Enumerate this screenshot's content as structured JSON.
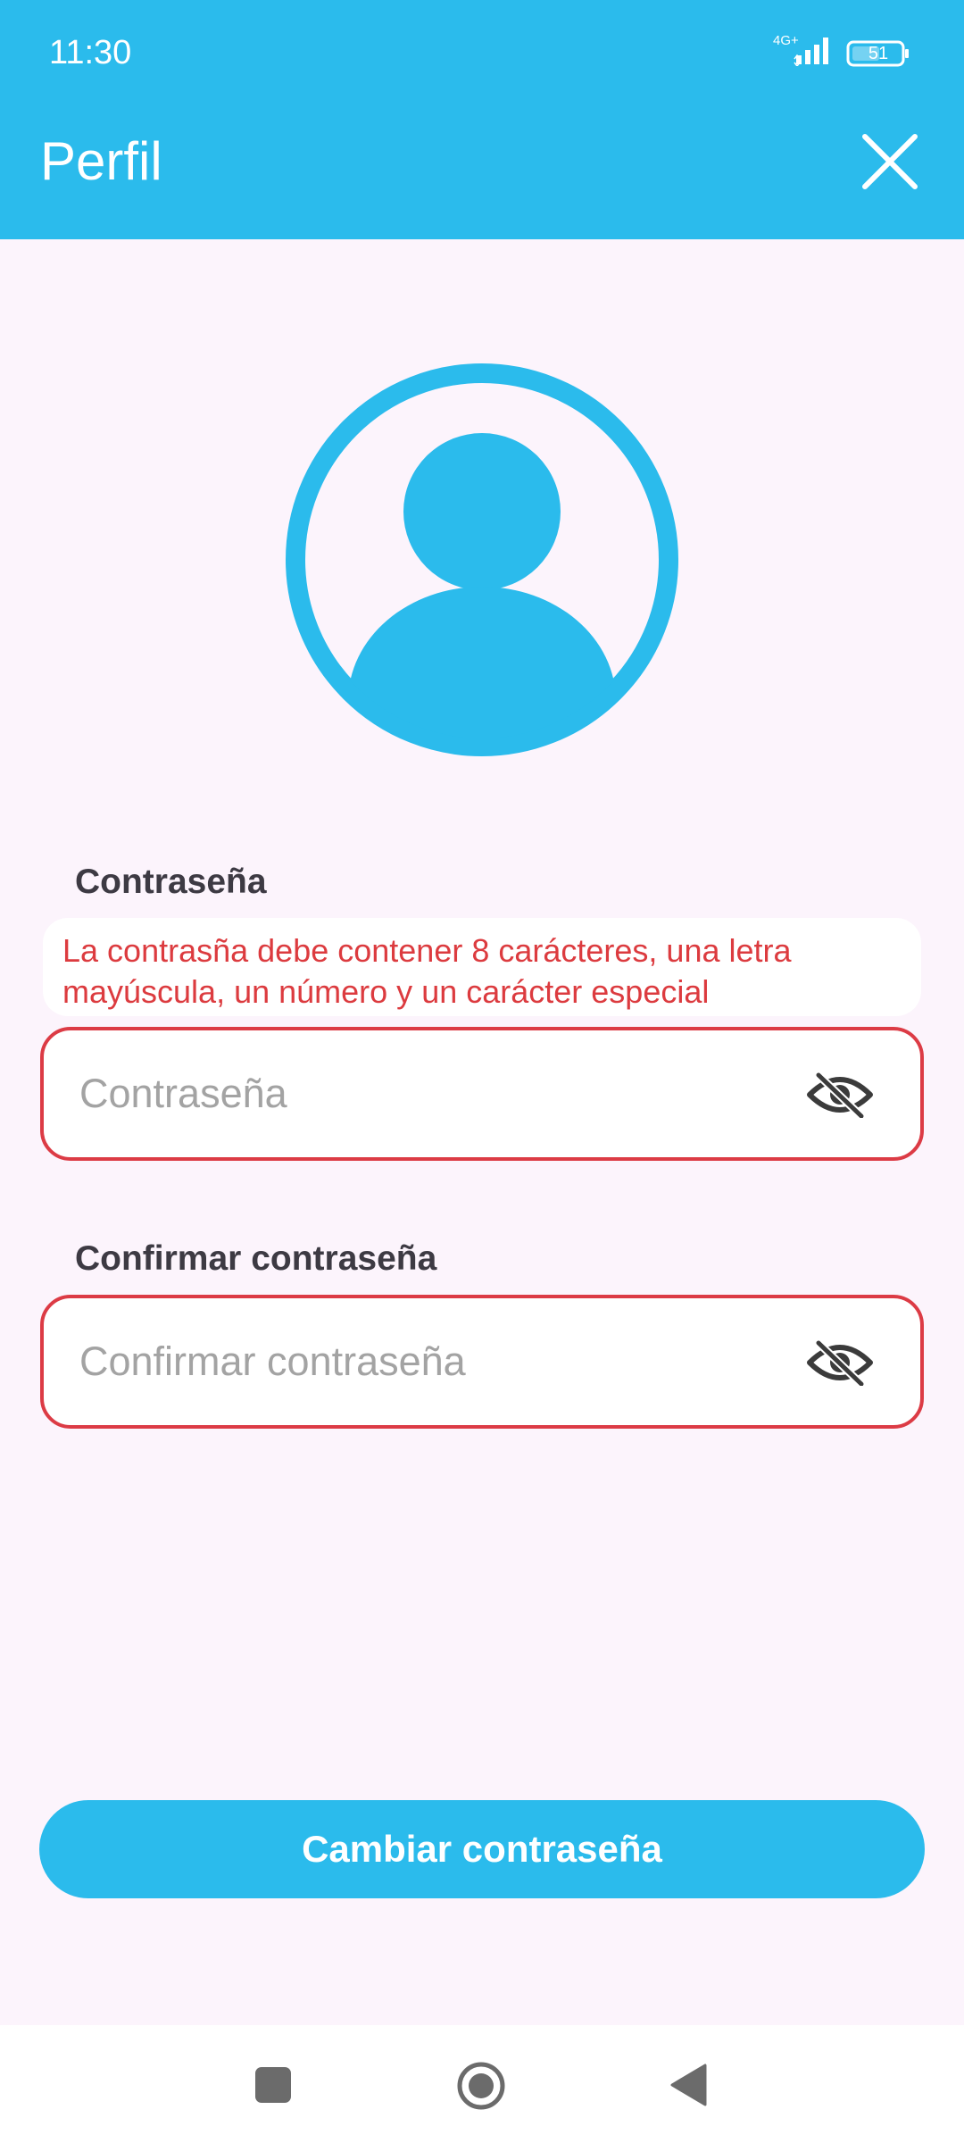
{
  "status_bar": {
    "time": "11:30",
    "network": "4G+",
    "battery": "51"
  },
  "header": {
    "title": "Perfil",
    "close_icon": "close-icon"
  },
  "avatar": {
    "icon": "user-avatar-icon",
    "color": "#2bbbec"
  },
  "password": {
    "label": "Contraseña",
    "hint": "La contrasña debe contener 8 carácteres, una letra mayúscula, un número y un carácter especial",
    "placeholder": "Contraseña",
    "value": "",
    "toggle_icon": "eye-off-icon"
  },
  "confirm_password": {
    "label": "Confirmar contraseña",
    "placeholder": "Confirmar contraseña",
    "value": "",
    "toggle_icon": "eye-off-icon"
  },
  "submit": {
    "label": "Cambiar contraseña"
  },
  "nav_bar": {
    "icons": [
      "recents-square-icon",
      "home-circle-icon",
      "back-triangle-icon"
    ]
  },
  "colors": {
    "primary": "#2bbbec",
    "error": "#dc3b3f",
    "background": "#fcf4fc",
    "label": "#3d3a43"
  }
}
